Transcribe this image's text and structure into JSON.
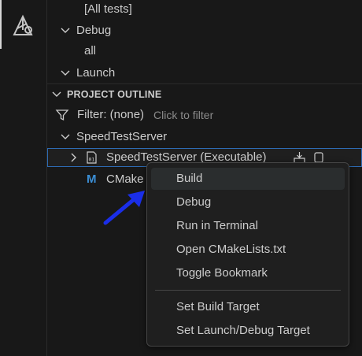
{
  "tree": {
    "all_tests": "[All tests]",
    "debug": "Debug",
    "debug_all": "all",
    "launch": "Launch"
  },
  "outline": {
    "header": "PROJECT OUTLINE",
    "filter_label": "Filter: (none)",
    "filter_hint": "Click to filter",
    "project": "SpeedTestServer",
    "target": "SpeedTestServer (Executable)",
    "cmake_file_partial": "CMake"
  },
  "context_menu": {
    "items": [
      "Build",
      "Debug",
      "Run in Terminal",
      "Open CMakeLists.txt",
      "Toggle Bookmark"
    ],
    "items2": [
      "Set Build Target",
      "Set Launch/Debug Target"
    ]
  },
  "colors": {
    "accent": "#2d6bb3",
    "arrow": "#1a2ee8",
    "cmake_m": "#3b8fd6"
  },
  "icons": [
    "cmake-icon",
    "chevron-down-icon",
    "chevron-right-icon",
    "filter-icon",
    "build-icon",
    "debug-icon",
    "executable-icon"
  ]
}
